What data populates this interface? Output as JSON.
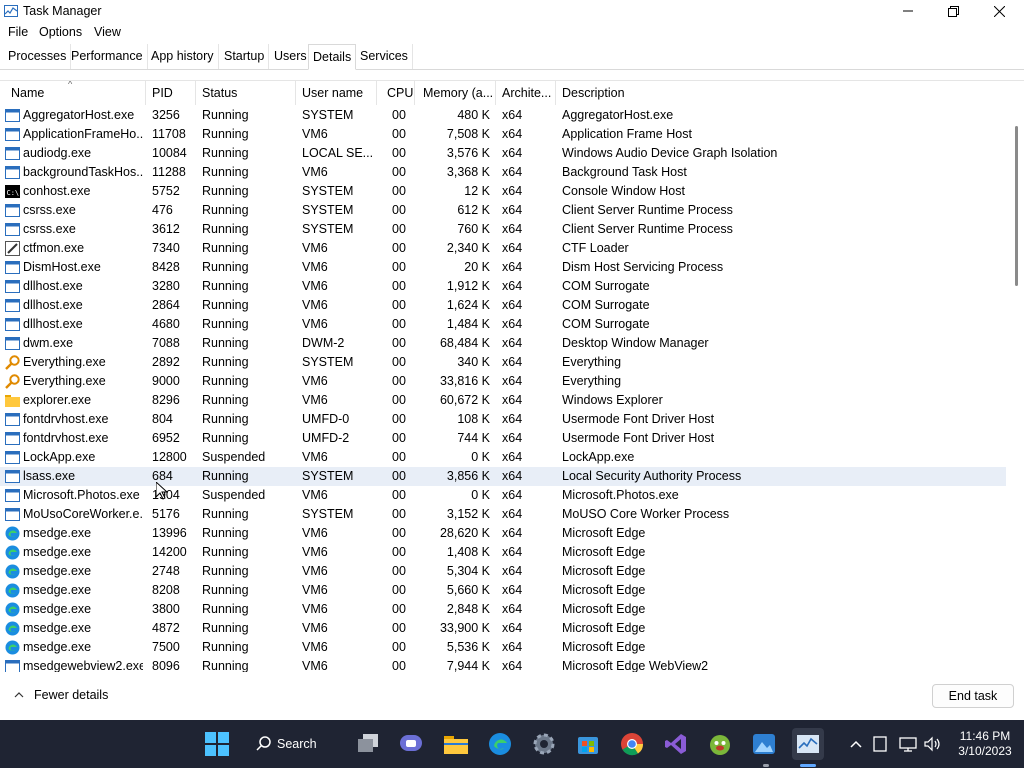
{
  "window": {
    "title": "Task Manager"
  },
  "menu": [
    "File",
    "Options",
    "View"
  ],
  "tabs": [
    "Processes",
    "Performance",
    "App history",
    "Startup",
    "Users",
    "Details",
    "Services"
  ],
  "active_tab": "Details",
  "columns": [
    "Name",
    "PID",
    "Status",
    "User name",
    "CPU",
    "Memory (a...",
    "Archite...",
    "Description"
  ],
  "rows": [
    {
      "icon": "app-icon",
      "name": "AggregatorHost.exe",
      "pid": "3256",
      "status": "Running",
      "user": "SYSTEM",
      "cpu": "00",
      "mem": "480 K",
      "arch": "x64",
      "desc": "AggregatorHost.exe"
    },
    {
      "icon": "app-icon",
      "name": "ApplicationFrameHo...",
      "pid": "11708",
      "status": "Running",
      "user": "VM6",
      "cpu": "00",
      "mem": "7,508 K",
      "arch": "x64",
      "desc": "Application Frame Host"
    },
    {
      "icon": "app-icon",
      "name": "audiodg.exe",
      "pid": "10084",
      "status": "Running",
      "user": "LOCAL SE...",
      "cpu": "00",
      "mem": "3,576 K",
      "arch": "x64",
      "desc": "Windows Audio Device Graph Isolation"
    },
    {
      "icon": "app-icon",
      "name": "backgroundTaskHos...",
      "pid": "11288",
      "status": "Running",
      "user": "VM6",
      "cpu": "00",
      "mem": "3,368 K",
      "arch": "x64",
      "desc": "Background Task Host"
    },
    {
      "icon": "console-icon",
      "name": "conhost.exe",
      "pid": "5752",
      "status": "Running",
      "user": "SYSTEM",
      "cpu": "00",
      "mem": "12 K",
      "arch": "x64",
      "desc": "Console Window Host"
    },
    {
      "icon": "app-icon",
      "name": "csrss.exe",
      "pid": "476",
      "status": "Running",
      "user": "SYSTEM",
      "cpu": "00",
      "mem": "612 K",
      "arch": "x64",
      "desc": "Client Server Runtime Process"
    },
    {
      "icon": "app-icon",
      "name": "csrss.exe",
      "pid": "3612",
      "status": "Running",
      "user": "SYSTEM",
      "cpu": "00",
      "mem": "760 K",
      "arch": "x64",
      "desc": "Client Server Runtime Process"
    },
    {
      "icon": "pen-icon",
      "name": "ctfmon.exe",
      "pid": "7340",
      "status": "Running",
      "user": "VM6",
      "cpu": "00",
      "mem": "2,340 K",
      "arch": "x64",
      "desc": "CTF Loader"
    },
    {
      "icon": "app-icon",
      "name": "DismHost.exe",
      "pid": "8428",
      "status": "Running",
      "user": "VM6",
      "cpu": "00",
      "mem": "20 K",
      "arch": "x64",
      "desc": "Dism Host Servicing Process"
    },
    {
      "icon": "app-icon",
      "name": "dllhost.exe",
      "pid": "3280",
      "status": "Running",
      "user": "VM6",
      "cpu": "00",
      "mem": "1,912 K",
      "arch": "x64",
      "desc": "COM Surrogate"
    },
    {
      "icon": "app-icon",
      "name": "dllhost.exe",
      "pid": "2864",
      "status": "Running",
      "user": "VM6",
      "cpu": "00",
      "mem": "1,624 K",
      "arch": "x64",
      "desc": "COM Surrogate"
    },
    {
      "icon": "app-icon",
      "name": "dllhost.exe",
      "pid": "4680",
      "status": "Running",
      "user": "VM6",
      "cpu": "00",
      "mem": "1,484 K",
      "arch": "x64",
      "desc": "COM Surrogate"
    },
    {
      "icon": "app-icon",
      "name": "dwm.exe",
      "pid": "7088",
      "status": "Running",
      "user": "DWM-2",
      "cpu": "00",
      "mem": "68,484 K",
      "arch": "x64",
      "desc": "Desktop Window Manager"
    },
    {
      "icon": "search-everything-icon",
      "name": "Everything.exe",
      "pid": "2892",
      "status": "Running",
      "user": "SYSTEM",
      "cpu": "00",
      "mem": "340 K",
      "arch": "x64",
      "desc": "Everything"
    },
    {
      "icon": "search-everything-icon",
      "name": "Everything.exe",
      "pid": "9000",
      "status": "Running",
      "user": "VM6",
      "cpu": "00",
      "mem": "33,816 K",
      "arch": "x64",
      "desc": "Everything"
    },
    {
      "icon": "folder-icon",
      "name": "explorer.exe",
      "pid": "8296",
      "status": "Running",
      "user": "VM6",
      "cpu": "00",
      "mem": "60,672 K",
      "arch": "x64",
      "desc": "Windows Explorer"
    },
    {
      "icon": "app-icon",
      "name": "fontdrvhost.exe",
      "pid": "804",
      "status": "Running",
      "user": "UMFD-0",
      "cpu": "00",
      "mem": "108 K",
      "arch": "x64",
      "desc": "Usermode Font Driver Host"
    },
    {
      "icon": "app-icon",
      "name": "fontdrvhost.exe",
      "pid": "6952",
      "status": "Running",
      "user": "UMFD-2",
      "cpu": "00",
      "mem": "744 K",
      "arch": "x64",
      "desc": "Usermode Font Driver Host"
    },
    {
      "icon": "app-icon",
      "name": "LockApp.exe",
      "pid": "12800",
      "status": "Suspended",
      "user": "VM6",
      "cpu": "00",
      "mem": "0 K",
      "arch": "x64",
      "desc": "LockApp.exe"
    },
    {
      "icon": "app-icon",
      "name": "lsass.exe",
      "pid": "684",
      "status": "Running",
      "user": "SYSTEM",
      "cpu": "00",
      "mem": "3,856 K",
      "arch": "x64",
      "desc": "Local Security Authority Process"
    },
    {
      "icon": "app-icon",
      "name": "Microsoft.Photos.exe",
      "pid": "1904",
      "status": "Suspended",
      "user": "VM6",
      "cpu": "00",
      "mem": "0 K",
      "arch": "x64",
      "desc": "Microsoft.Photos.exe"
    },
    {
      "icon": "app-icon",
      "name": "MoUsoCoreWorker.e...",
      "pid": "5176",
      "status": "Running",
      "user": "SYSTEM",
      "cpu": "00",
      "mem": "3,152 K",
      "arch": "x64",
      "desc": "MoUSO Core Worker Process"
    },
    {
      "icon": "edge-icon",
      "name": "msedge.exe",
      "pid": "13996",
      "status": "Running",
      "user": "VM6",
      "cpu": "00",
      "mem": "28,620 K",
      "arch": "x64",
      "desc": "Microsoft Edge"
    },
    {
      "icon": "edge-icon",
      "name": "msedge.exe",
      "pid": "14200",
      "status": "Running",
      "user": "VM6",
      "cpu": "00",
      "mem": "1,408 K",
      "arch": "x64",
      "desc": "Microsoft Edge"
    },
    {
      "icon": "edge-icon",
      "name": "msedge.exe",
      "pid": "2748",
      "status": "Running",
      "user": "VM6",
      "cpu": "00",
      "mem": "5,304 K",
      "arch": "x64",
      "desc": "Microsoft Edge"
    },
    {
      "icon": "edge-icon",
      "name": "msedge.exe",
      "pid": "8208",
      "status": "Running",
      "user": "VM6",
      "cpu": "00",
      "mem": "5,660 K",
      "arch": "x64",
      "desc": "Microsoft Edge"
    },
    {
      "icon": "edge-icon",
      "name": "msedge.exe",
      "pid": "3800",
      "status": "Running",
      "user": "VM6",
      "cpu": "00",
      "mem": "2,848 K",
      "arch": "x64",
      "desc": "Microsoft Edge"
    },
    {
      "icon": "edge-icon",
      "name": "msedge.exe",
      "pid": "4872",
      "status": "Running",
      "user": "VM6",
      "cpu": "00",
      "mem": "33,900 K",
      "arch": "x64",
      "desc": "Microsoft Edge"
    },
    {
      "icon": "edge-icon",
      "name": "msedge.exe",
      "pid": "7500",
      "status": "Running",
      "user": "VM6",
      "cpu": "00",
      "mem": "5,536 K",
      "arch": "x64",
      "desc": "Microsoft Edge"
    },
    {
      "icon": "app-icon",
      "name": "msedgewebview2.exe",
      "pid": "8096",
      "status": "Running",
      "user": "VM6",
      "cpu": "00",
      "mem": "7,944 K",
      "arch": "x64",
      "desc": "Microsoft Edge WebView2"
    }
  ],
  "selected_row": "lsass.exe",
  "footer": {
    "fewer_details": "Fewer details",
    "end_task": "End task"
  },
  "taskbar": {
    "search_label": "Search",
    "items": [
      "start-icon",
      "search-icon",
      "task-view-icon",
      "chat-icon",
      "file-explorer-icon",
      "edge-icon",
      "settings-icon",
      "store-icon",
      "chrome-icon",
      "visual-studio-icon",
      "game-icon",
      "photos-icon",
      "task-manager-icon"
    ],
    "tray": [
      "chevron-up-icon",
      "tablet-icon",
      "network-icon",
      "volume-icon"
    ],
    "time": "11:46 PM",
    "date": "3/10/2023"
  },
  "colors": {
    "selected_row": "#e8eef7",
    "taskbar": "#1f2433",
    "accent": "#0078d4"
  }
}
